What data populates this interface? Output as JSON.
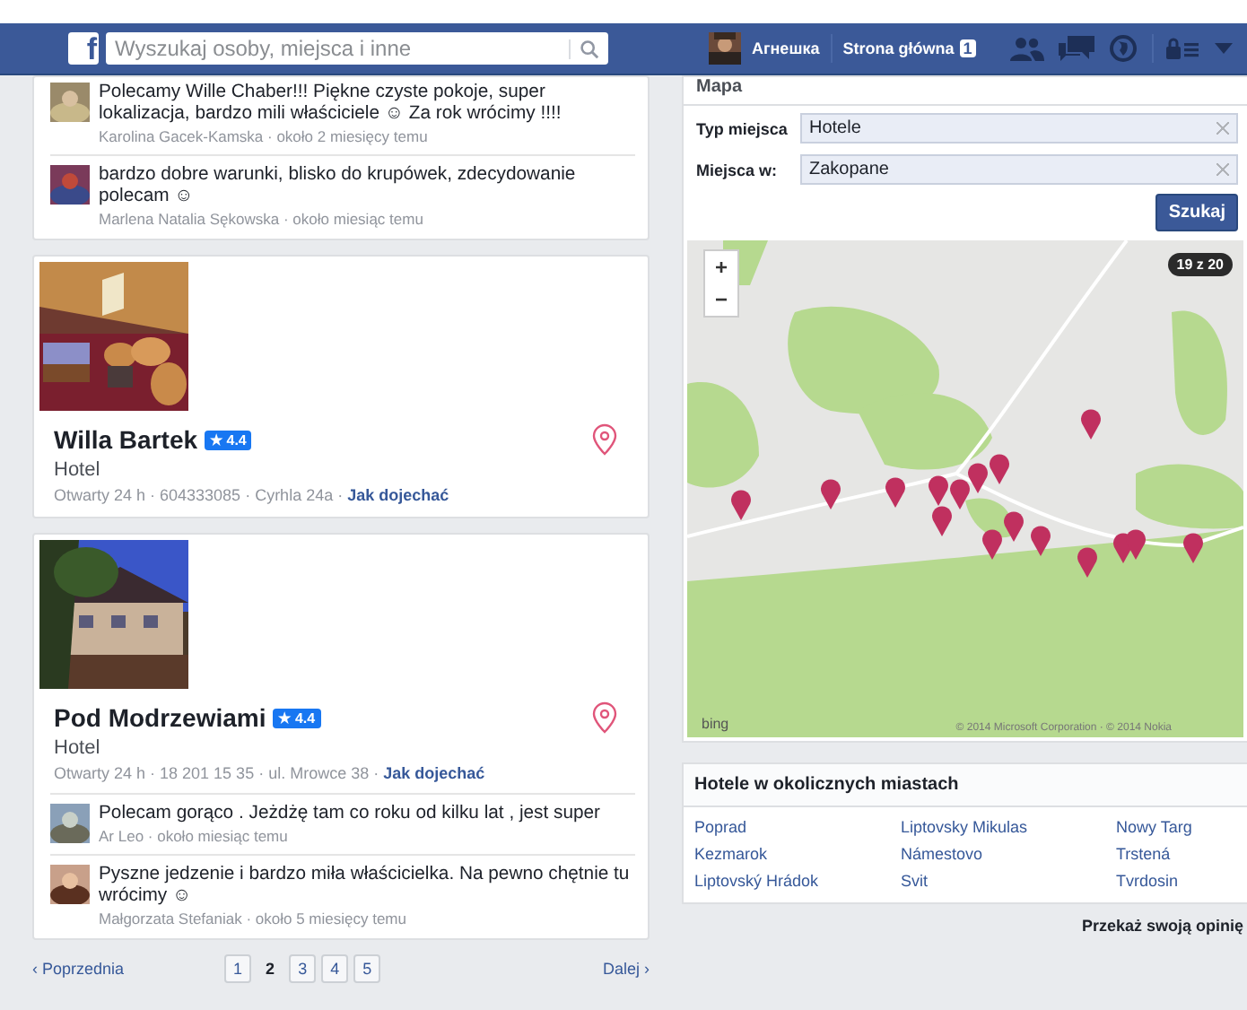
{
  "topbar": {
    "logo": "f",
    "search": {
      "placeholder": "Wyszukaj osoby, miejsca i inne"
    },
    "user": "Агнешка",
    "home": "Strona główna",
    "home_badge": "1"
  },
  "results": [
    {
      "kind": "reviews",
      "reviews": [
        {
          "text": "Polecamy Wille Chaber!!! Piękne czyste pokoje, super lokalizacja, bardzo mili właściciele ☺ Za rok wrócimy !!!!",
          "meta": "Karolina Gacek-Kamska · około 2 miesięcy temu"
        },
        {
          "text": "bardzo dobre warunki, blisko do krupówek, zdecydowanie polecam ☺",
          "meta": "Marlena Natalia Sękowska · około miesiąc temu"
        }
      ]
    },
    {
      "kind": "hotel",
      "name": "Willa Bartek",
      "rating": "★ 4.4",
      "category": "Hotel",
      "details": "Otwarty 24 h · 604333085 · Cyrhla 24a · ",
      "directions": "Jak dojechać"
    },
    {
      "kind": "hotel",
      "name": "Pod Modrzewiami",
      "rating": "★ 4.4",
      "category": "Hotel",
      "details": "Otwarty 24 h · 18 201 15 35 · ul. Mrowce 38 · ",
      "directions": "Jak dojechać",
      "reviews": [
        {
          "text": "Polecam gorąco . Jeżdżę tam co roku od kilku lat , jest super",
          "meta": "Ar Leo · około miesiąc temu"
        },
        {
          "text": "Pyszne jedzenie i bardzo miła właścicielka. Na pewno chętnie tu wrócimy ☺",
          "meta": "Małgorzata Stefaniak · około 5 miesięcy temu"
        }
      ]
    }
  ],
  "pagination": {
    "prev": "‹ Poprzednia",
    "pages": [
      {
        "label": "1",
        "selected": false
      },
      {
        "label": "2",
        "selected": true
      },
      {
        "label": "3",
        "selected": false
      },
      {
        "label": "4",
        "selected": false
      },
      {
        "label": "5",
        "selected": false
      }
    ],
    "next": "Dalej ›"
  },
  "map_panel": {
    "title": "Mapa",
    "fields": [
      {
        "label": "Typ miejsca",
        "value": "Hotele"
      },
      {
        "label": "Miejsca w:",
        "value": "Zakopane"
      }
    ],
    "button": "Szukaj",
    "zoom_in": "+",
    "zoom_out": "−",
    "count": "19 z 20",
    "provider": "bing",
    "copyright": "© 2014 Microsoft Corporation · © 2014 Nokia"
  },
  "nearby": {
    "title": "Hotele w okolicznych miastach",
    "cities": [
      "Poprad",
      "Liptovsky Mikulas",
      "Nowy Targ",
      "Kezmarok",
      "Námestovo",
      "Trstená",
      "Liptovský Hrádok",
      "Svit",
      "Tvrdosin"
    ]
  },
  "feedback": "Przekaż swoją opinię"
}
